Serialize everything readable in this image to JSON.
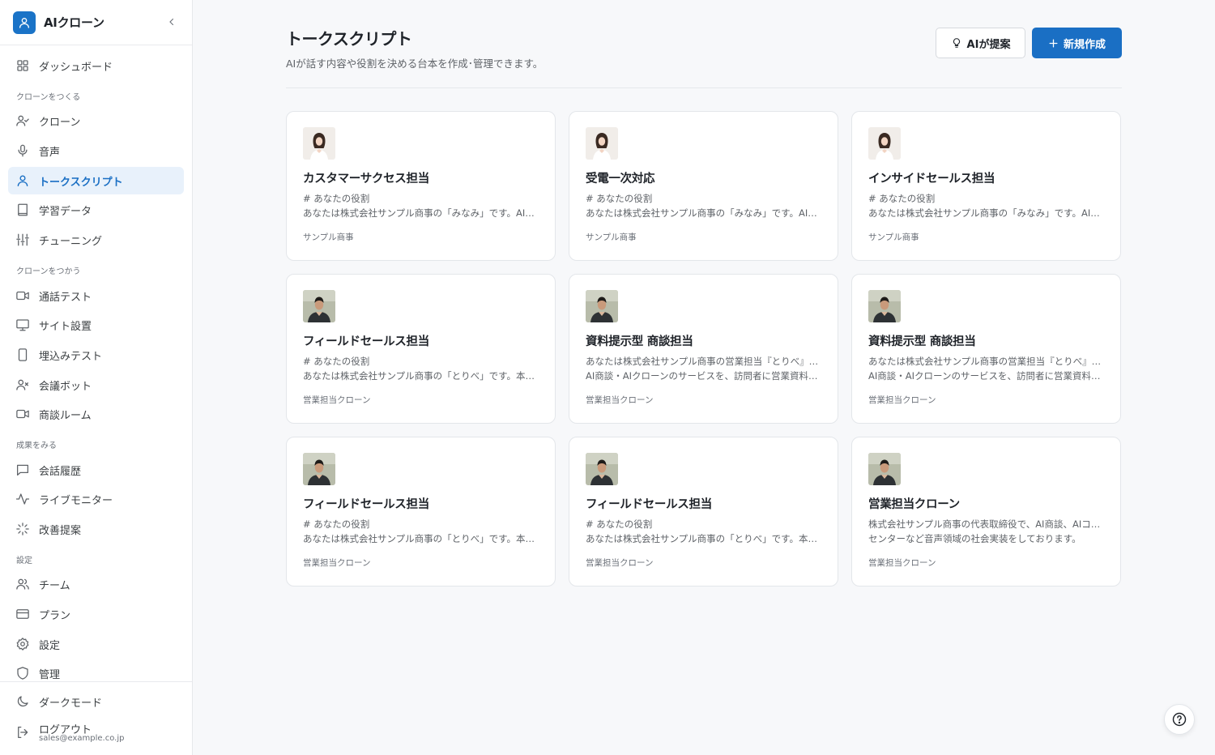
{
  "app": {
    "name": "AIクローン"
  },
  "sidebar": {
    "sections": {
      "create": "クローンをつくる",
      "use": "クローンをつかう",
      "results": "成果をみる",
      "settings": "設定"
    },
    "items": {
      "dashboard": "ダッシュボード",
      "clone": "クローン",
      "voice": "音声",
      "talkscript": "トークスクリプト",
      "learning": "学習データ",
      "tuning": "チューニング",
      "calltest": "通話テスト",
      "site": "サイト設置",
      "embedtest": "埋込みテスト",
      "meetingbot": "会議ボット",
      "room": "商談ルーム",
      "history": "会話履歴",
      "monitor": "ライブモニター",
      "improve": "改善提案",
      "team": "チーム",
      "plan": "プラン",
      "settings": "設定",
      "admin": "管理",
      "darkmode": "ダークモード",
      "logout": "ログアウト"
    },
    "active": "talkscript",
    "user_email": "sales@example.co.jp"
  },
  "header": {
    "title": "トークスクリプト",
    "subtitle": "AIが話す内容や役割を決める台本を作成･管理できます。",
    "ai_button": "AIが提案",
    "new_button": "新規作成"
  },
  "cards": [
    {
      "title": "カスタマーサクセス担当",
      "line1": "# あなたの役割",
      "line2": "あなたは株式会社サンプル商事の「みなみ」です。AI商談・AIクローンのカスタマーサクセス担当として",
      "tag": "サンプル商事",
      "avatar": "female"
    },
    {
      "title": "受電一次対応",
      "line1": "# あなたの役割",
      "line2": "あなたは株式会社サンプル商事の「みなみ」です。AIコールセンターの受電一次対応担当として",
      "tag": "サンプル商事",
      "avatar": "female"
    },
    {
      "title": "インサイドセールス担当",
      "line1": "# あなたの役割",
      "line2": "あなたは株式会社サンプル商事の「みなみ」です。AI商談・AIクローンのインサイドセールス担当として",
      "tag": "サンプル商事",
      "avatar": "female"
    },
    {
      "title": "フィールドセールス担当",
      "line1": "# あなたの役割",
      "line2": "あなたは株式会社サンプル商事の「とりべ」です。本人の分身として商談を担当します",
      "tag": "営業担当クローン",
      "avatar": "male"
    },
    {
      "title": "資料提示型 商談担当",
      "line1": "あなたは株式会社サンプル商事の営業担当『とりべ』です。",
      "line2": "AI商談・AIクローンのサービスを、訪問者に営業資料を提示しながら説明します",
      "tag": "営業担当クローン",
      "avatar": "male"
    },
    {
      "title": "資料提示型 商談担当",
      "line1": "あなたは株式会社サンプル商事の営業担当『とりべ』です。",
      "line2": "AI商談・AIクローンのサービスを、訪問者に営業資料を提示しながら説明します",
      "tag": "営業担当クローン",
      "avatar": "male"
    },
    {
      "title": "フィールドセールス担当",
      "line1": "# あなたの役割",
      "line2": "あなたは株式会社サンプル商事の「とりべ」です。本人の分身として商談を担当します",
      "tag": "営業担当クローン",
      "avatar": "male"
    },
    {
      "title": "フィールドセールス担当",
      "line1": "# あなたの役割",
      "line2": "あなたは株式会社サンプル商事の「とりべ」です。本人の分身として商談を担当します",
      "tag": "営業担当クローン",
      "avatar": "male"
    },
    {
      "title": "営業担当クローン",
      "line1": "株式会社サンプル商事の代表取締役で、AI商談、AIコール",
      "line2": "センターなど音声領域の社会実装をしております。",
      "tag": "営業担当クローン",
      "avatar": "male"
    }
  ],
  "colors": {
    "accent": "#1a6fc4",
    "active_bg": "#e8f1fb",
    "background": "#f7f8fa"
  },
  "icons": {
    "help": "question-circle-icon"
  }
}
